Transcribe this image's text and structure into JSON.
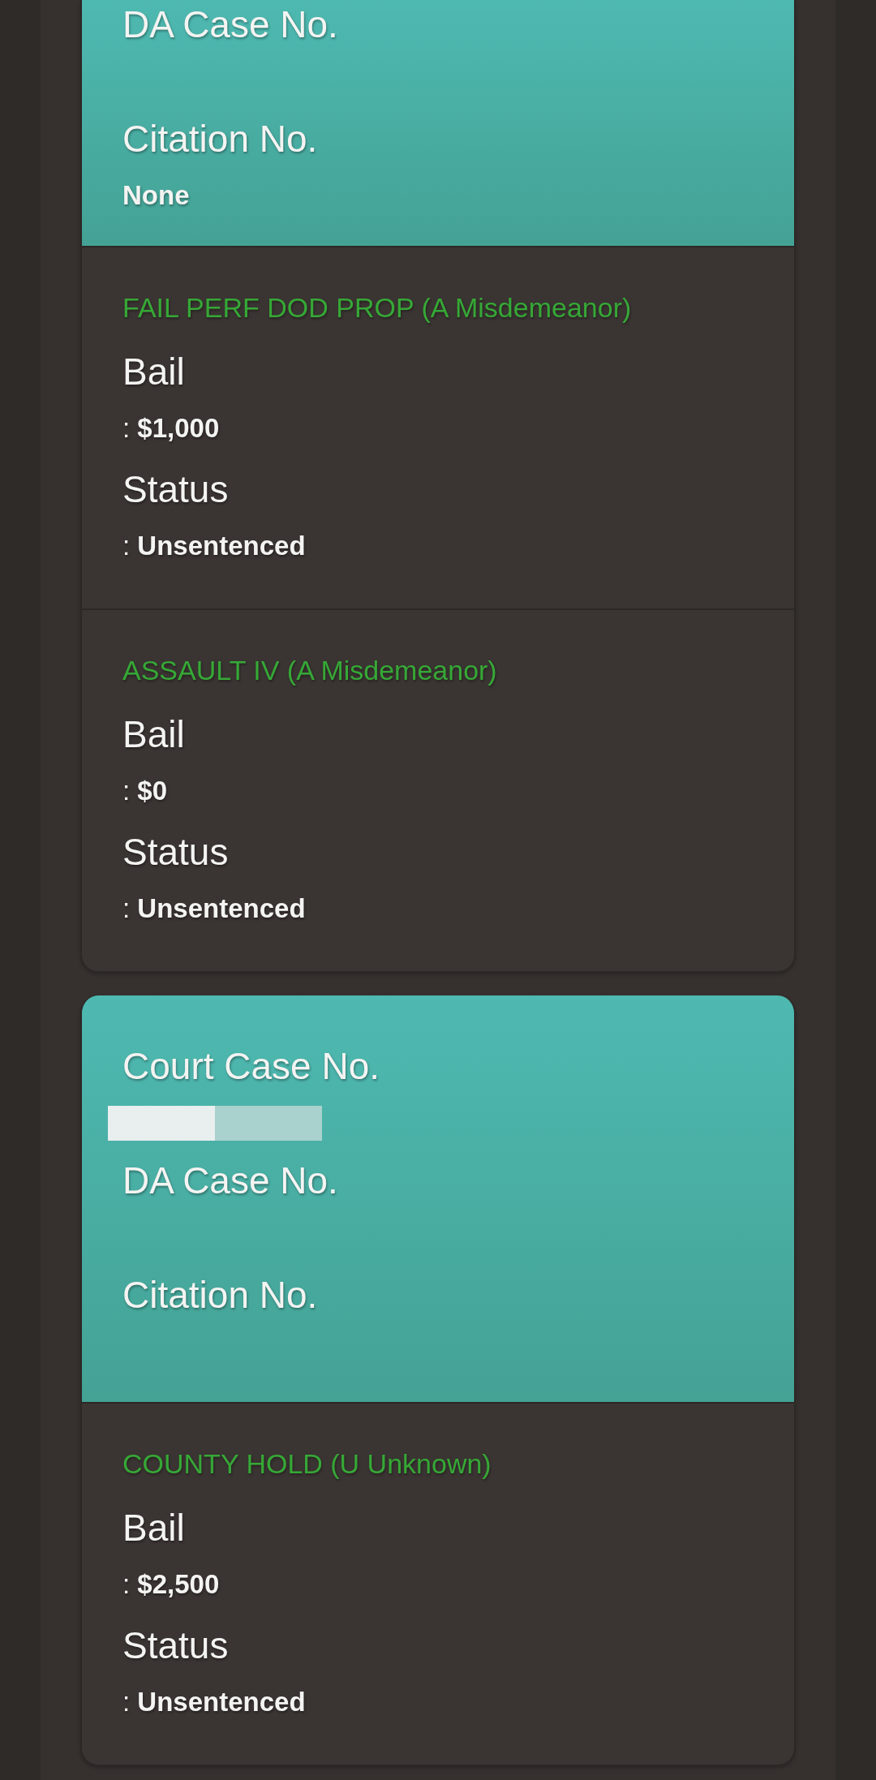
{
  "cases": [
    {
      "fields": [
        {
          "label": "DA Case No.",
          "redacted": false
        },
        {
          "label": "Citation No.",
          "value": "None",
          "redacted": false
        }
      ],
      "charges": [
        {
          "title": "FAIL PERF DOD PROP (A Misdemeanor)",
          "details": [
            {
              "label": "Bail",
              "value": ": **$1,000**"
            },
            {
              "label": "Status",
              "value": ": **Unsentenced**"
            }
          ]
        },
        {
          "title": "ASSAULT IV (A Misdemeanor)",
          "details": [
            {
              "label": "Bail",
              "value": ": **$0**"
            },
            {
              "label": "Status",
              "value": ": **Unsentenced**"
            }
          ]
        }
      ]
    },
    {
      "fields": [
        {
          "label": "Court Case No.",
          "redacted": true
        },
        {
          "label": "DA Case No.",
          "redacted": false
        },
        {
          "label": "Citation No.",
          "redacted": false
        }
      ],
      "charges": [
        {
          "title": "COUNTY HOLD (U Unknown)",
          "details": [
            {
              "label": "Bail",
              "value": ": **$2,500**"
            },
            {
              "label": "Status",
              "value": ": **Unsentenced**"
            }
          ]
        }
      ]
    }
  ]
}
